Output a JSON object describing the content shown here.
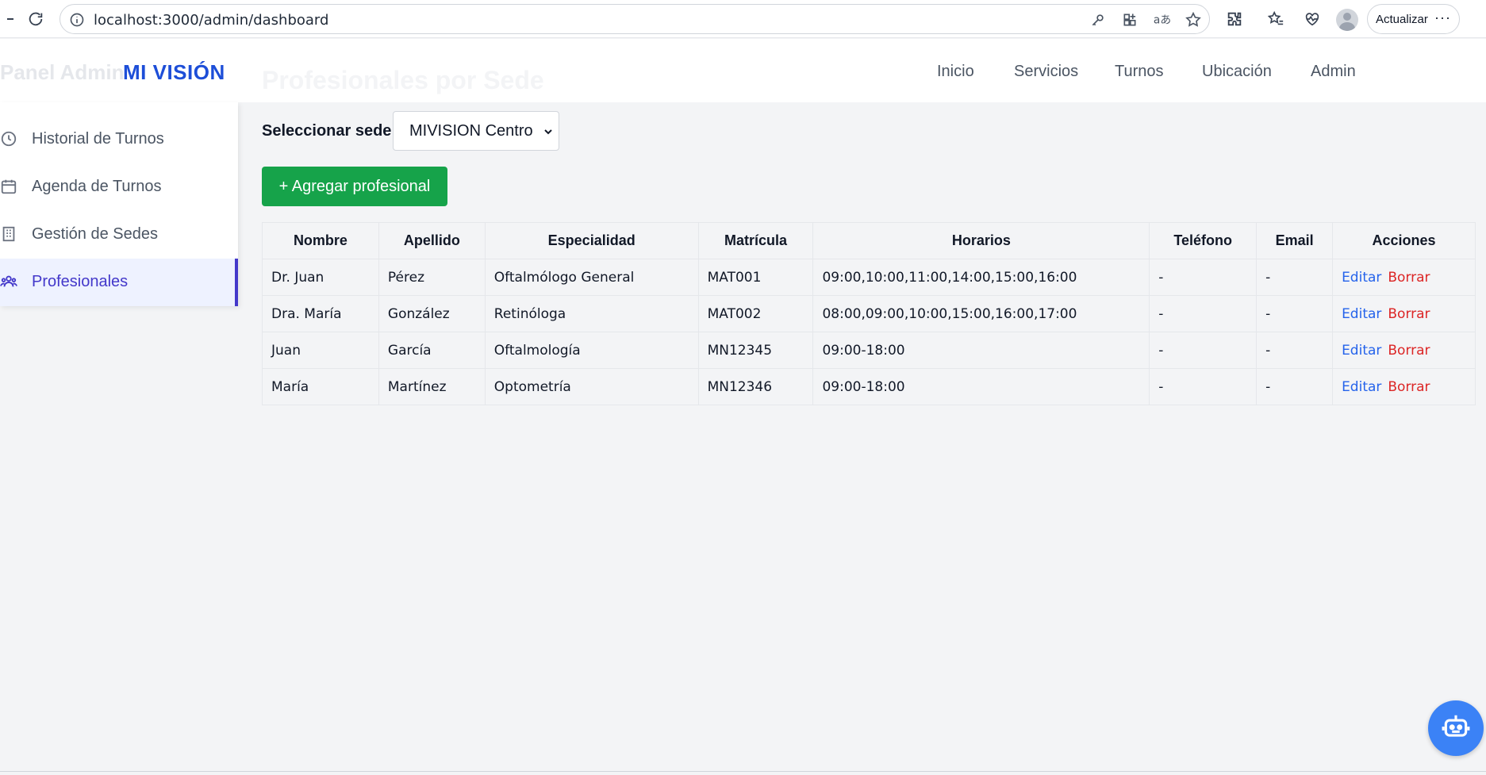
{
  "browser": {
    "url": "localhost:3000/admin/dashboard",
    "update_label": "Actualizar",
    "more_label": "···"
  },
  "app": {
    "ghost_title": "Panel Admin",
    "brand": "MI VISIÓN",
    "ghost_heading": "Profesionales por Sede",
    "nav": [
      "Inicio",
      "Servicios",
      "Turnos",
      "Ubicación",
      "Admin"
    ]
  },
  "sidebar": {
    "items": [
      {
        "label": "Historial de Turnos",
        "icon": "clock-icon"
      },
      {
        "label": "Agenda de Turnos",
        "icon": "calendar-icon"
      },
      {
        "label": "Gestión de Sedes",
        "icon": "building-icon"
      },
      {
        "label": "Profesionales",
        "icon": "users-icon",
        "active": true
      }
    ]
  },
  "main": {
    "select_label": "Seleccionar sede:",
    "selected_sede": "MIVISION Centro",
    "add_button": "+ Agregar profesional",
    "table": {
      "headers": [
        "Nombre",
        "Apellido",
        "Especialidad",
        "Matrícula",
        "Horarios",
        "Teléfono",
        "Email",
        "Acciones"
      ],
      "rows": [
        [
          "Dr. Juan",
          "Pérez",
          "Oftalmólogo General",
          "MAT001",
          "09:00,10:00,11:00,14:00,15:00,16:00",
          "-",
          "-"
        ],
        [
          "Dra. María",
          "González",
          "Retinóloga",
          "MAT002",
          "08:00,09:00,10:00,15:00,16:00,17:00",
          "-",
          "-"
        ],
        [
          "Juan",
          "García",
          "Oftalmología",
          "MN12345",
          "09:00-18:00",
          "-",
          "-"
        ],
        [
          "María",
          "Martínez",
          "Optometría",
          "MN12346",
          "09:00-18:00",
          "-",
          "-"
        ]
      ],
      "edit_label": "Editar",
      "delete_label": "Borrar"
    }
  },
  "colors": {
    "brand": "#1d4ed8",
    "active_nav": "#4338ca",
    "add_button": "#16a34a",
    "edit_link": "#2563eb",
    "delete_link": "#dc2626",
    "bot_button": "#3b82f6"
  }
}
